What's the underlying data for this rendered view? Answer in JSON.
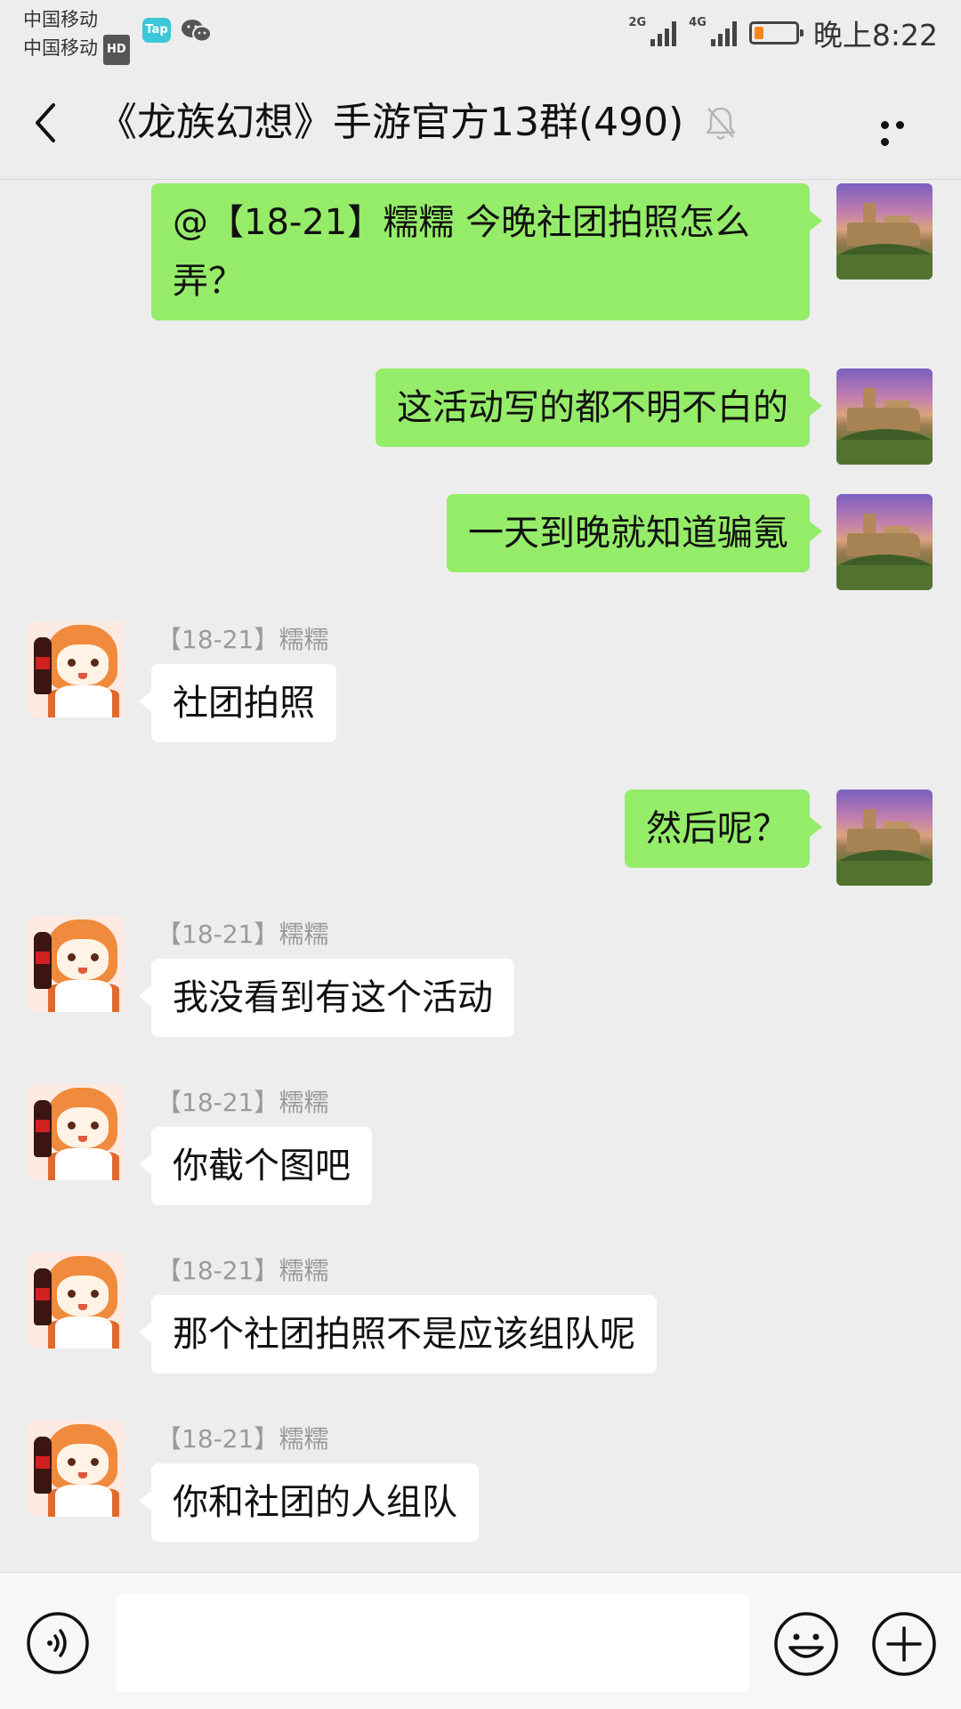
{
  "status_bar": {
    "carrier_1": "中国移动",
    "carrier_2": "中国移动",
    "hd_badge": "HD",
    "tap_label": "Tap",
    "net_1": "2G",
    "net_2": "4G",
    "time": "晚上8:22",
    "battery_level": 0.22,
    "battery_color": "#f5891f"
  },
  "nav": {
    "title": "《龙族幻想》手游官方13群(490)",
    "back_icon": "chevron-left-icon",
    "mute_icon": "bell-off-icon",
    "more_icon": "more-dots-icon"
  },
  "messages": [
    {
      "direction": "out",
      "text": "@【18-21】糯糯  今晚社团拍照怎么弄？"
    },
    {
      "direction": "out",
      "text": "这活动写的都不明不白的"
    },
    {
      "direction": "out",
      "text": "一天到晚就知道骗氪"
    },
    {
      "direction": "in",
      "sender": "【18-21】糯糯",
      "text": "社团拍照"
    },
    {
      "direction": "out",
      "text": "然后呢？"
    },
    {
      "direction": "in",
      "sender": "【18-21】糯糯",
      "text": "我没看到有这个活动"
    },
    {
      "direction": "in",
      "sender": "【18-21】糯糯",
      "text": "你截个图吧"
    },
    {
      "direction": "in",
      "sender": "【18-21】糯糯",
      "text": "那个社团拍照不是应该组队呢"
    },
    {
      "direction": "in",
      "sender": "【18-21】糯糯",
      "text": "你和社团的人组队"
    }
  ],
  "colors": {
    "outgoing_bubble": "#95ec69",
    "incoming_bubble": "#ffffff",
    "background": "#ededed"
  },
  "input_bar": {
    "placeholder": "",
    "voice_icon": "voice-icon",
    "emoji_icon": "emoji-icon",
    "plus_icon": "plus-icon"
  }
}
